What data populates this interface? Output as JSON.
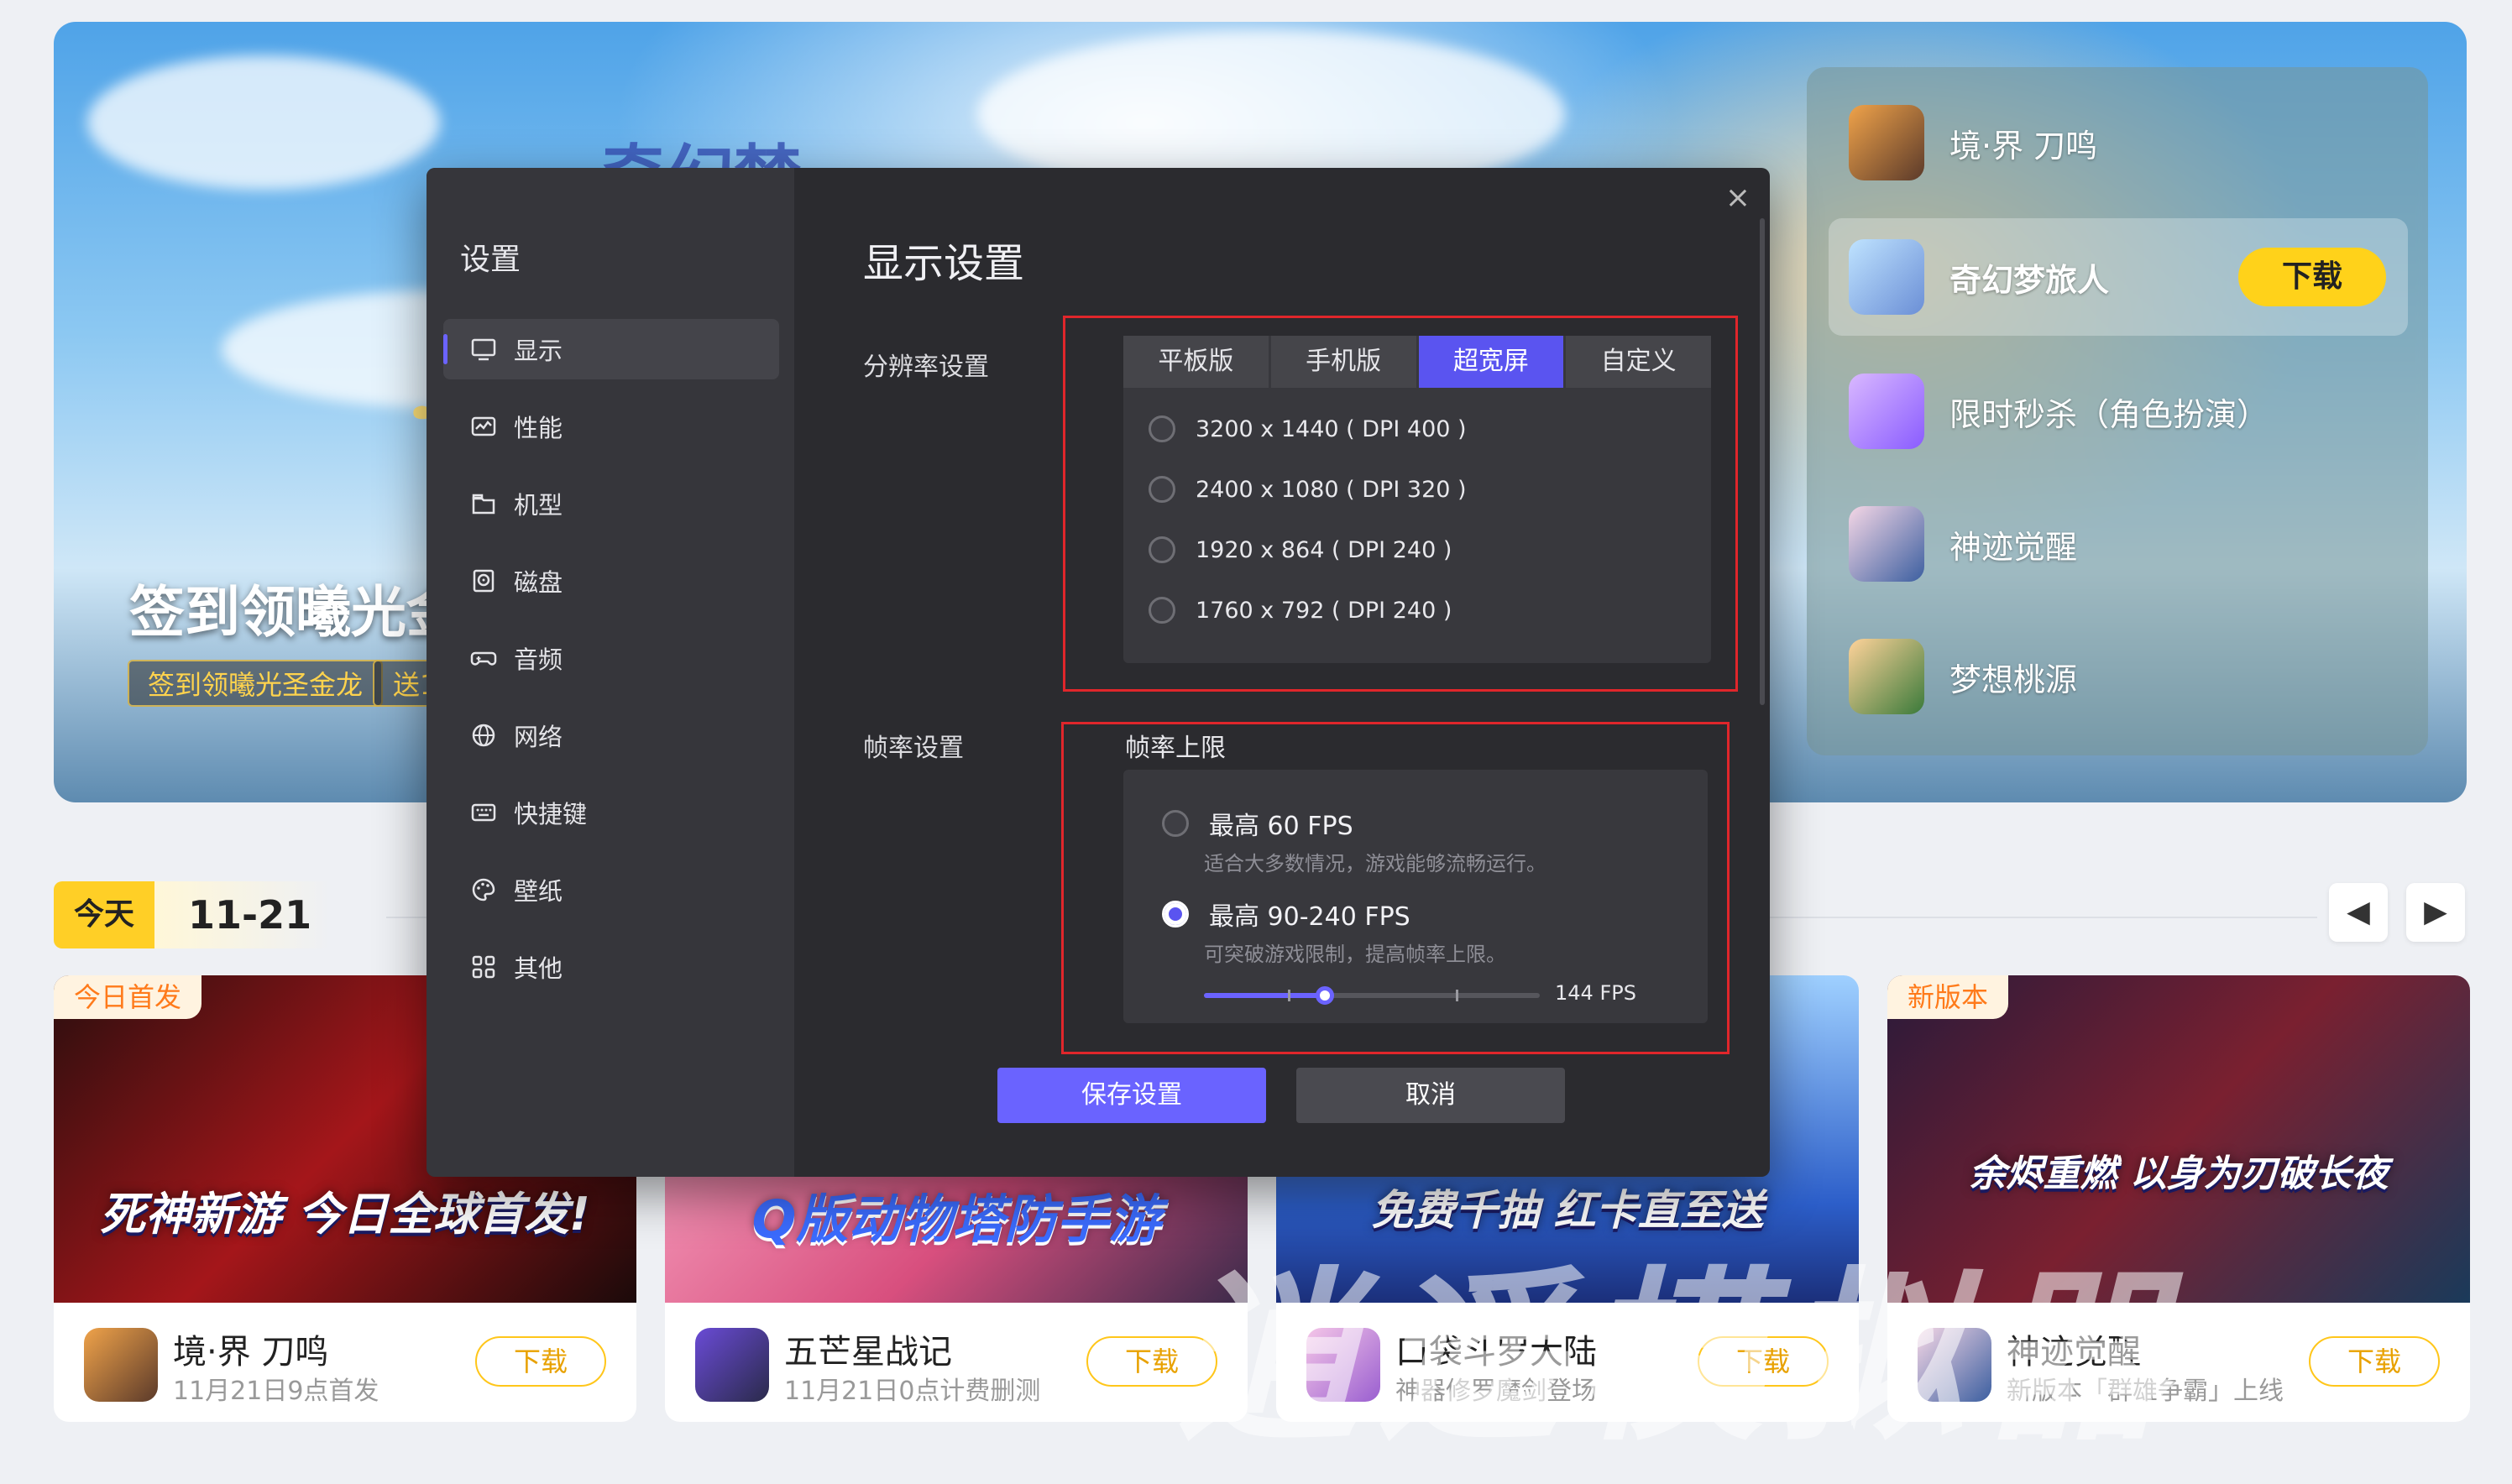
{
  "banner": {
    "headline": "签到领曦光金",
    "tag_1": "签到领曦光圣金龙",
    "tag_2": "送1"
  },
  "side_list": [
    {
      "name": "境·界 刀鸣"
    },
    {
      "name": "奇幻梦旅人",
      "button": "下载"
    },
    {
      "name": "限时秒杀（角色扮演）"
    },
    {
      "name": "神迹觉醒"
    },
    {
      "name": "梦想桃源"
    }
  ],
  "date_bar": {
    "today": "今天",
    "date": "11-21"
  },
  "cards": [
    {
      "ribbon": "今日首发",
      "art_text": "死神新游 今日全球首发!",
      "title": "境·界 刀鸣",
      "subtitle": "11月21日9点首发",
      "button": "下载"
    },
    {
      "ribbon": "",
      "art_text": "Q版动物塔防手游",
      "title": "五芒星战记",
      "subtitle": "11月21日0点计费删测",
      "button": "下载"
    },
    {
      "ribbon": "",
      "art_text": "免费千抽 红卡直至送",
      "title": "口袋斗罗大陆",
      "subtitle": "神器修罗魔剑登场",
      "button": "下载"
    },
    {
      "ribbon": "新版本",
      "art_text": "余烬重燃 以身为刃破长夜",
      "title": "神迹觉醒",
      "subtitle": "新版本「群雄争霸」上线",
      "button": "下载"
    }
  ],
  "watermark": "逍遥模拟器",
  "settings": {
    "title": "设置",
    "nav": [
      {
        "label": "显示",
        "icon": "monitor-icon"
      },
      {
        "label": "性能",
        "icon": "performance-icon"
      },
      {
        "label": "机型",
        "icon": "device-model-icon"
      },
      {
        "label": "磁盘",
        "icon": "disk-icon"
      },
      {
        "label": "音频",
        "icon": "gamepad-audio-icon"
      },
      {
        "label": "网络",
        "icon": "globe-icon"
      },
      {
        "label": "快捷键",
        "icon": "keyboard-icon"
      },
      {
        "label": "壁纸",
        "icon": "palette-icon"
      },
      {
        "label": "其他",
        "icon": "grid-icon"
      }
    ],
    "active_nav": "显示",
    "page_title": "显示设置",
    "resolution_label": "分辨率设置",
    "resolution_tabs": [
      "平板版",
      "手机版",
      "超宽屏",
      "自定义"
    ],
    "active_tab": "超宽屏",
    "resolutions": [
      "3200 x 1440 ( DPI 400 )",
      "2400 x 1080 ( DPI 320 )",
      "1920 x 864 ( DPI 240 )",
      "1760 x 792 ( DPI 240 )"
    ],
    "selected_resolution": null,
    "framerate_label": "帧率设置",
    "framerate_cap_title": "帧率上限",
    "fps_options": [
      {
        "label": "最高 60 FPS",
        "desc": "适合大多数情况，游戏能够流畅运行。",
        "selected": false
      },
      {
        "label": "最高 90-240 FPS",
        "desc": "可突破游戏限制，提高帧率上限。",
        "selected": true
      }
    ],
    "fps_slider": {
      "min": 90,
      "max": 240,
      "value": 144,
      "value_label": "144 FPS"
    },
    "save_button": "保存设置",
    "cancel_button": "取消",
    "close": "×",
    "accent_color": "#6a63ff",
    "highlight_color": "#e0262b"
  }
}
